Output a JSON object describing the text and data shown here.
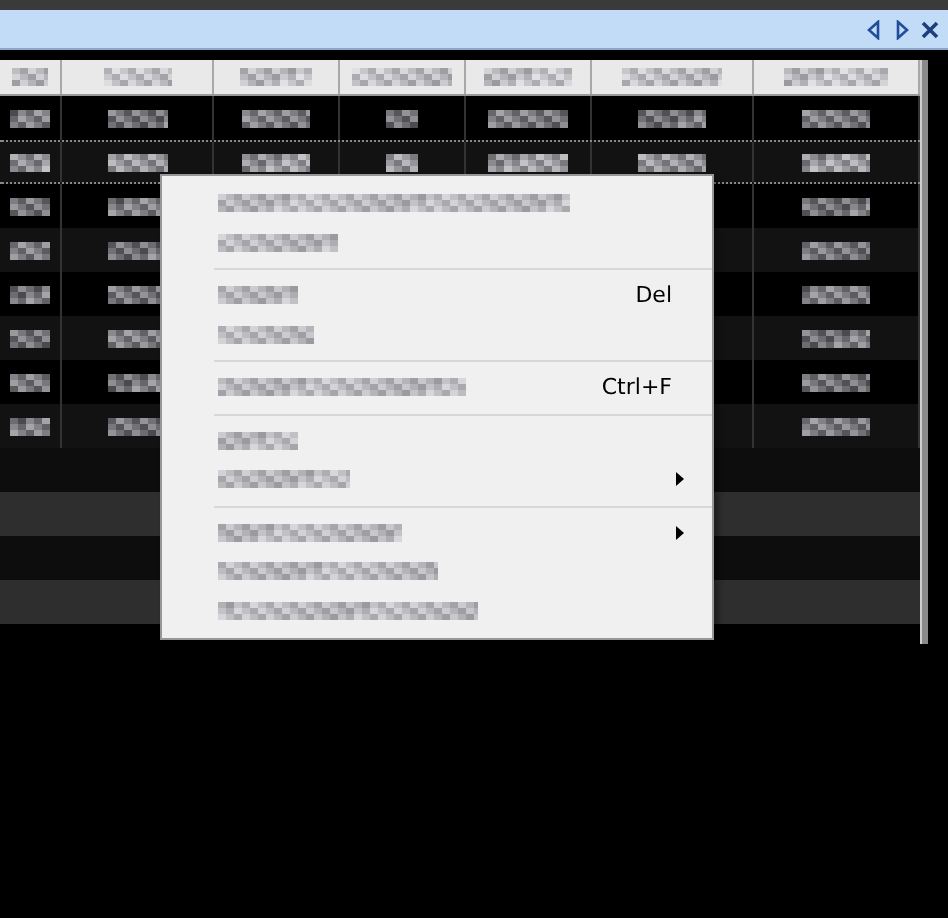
{
  "panel": {
    "buttons": [
      {
        "kind": "prev"
      },
      {
        "kind": "next"
      },
      {
        "kind": "close"
      }
    ]
  },
  "table": {
    "columns": [
      {
        "kind": "pixelated"
      },
      {
        "kind": "pixelated"
      },
      {
        "kind": "pixelated"
      },
      {
        "kind": "pixelated"
      },
      {
        "kind": "pixelated"
      },
      {
        "kind": "pixelated"
      },
      {
        "kind": "pixelated"
      }
    ],
    "rows": [
      {
        "kind": "data",
        "selected": false
      },
      {
        "kind": "data",
        "selected": true
      },
      {
        "kind": "data",
        "selected": false
      },
      {
        "kind": "data",
        "selected": false
      },
      {
        "kind": "data",
        "selected": false
      },
      {
        "kind": "data",
        "selected": false
      },
      {
        "kind": "data",
        "selected": false
      },
      {
        "kind": "data",
        "selected": false
      },
      {
        "kind": "empty",
        "selected": false
      },
      {
        "kind": "empty",
        "selected": false
      },
      {
        "kind": "empty",
        "selected": false
      },
      {
        "kind": "empty",
        "selected": false
      }
    ]
  },
  "context_menu": {
    "items": [
      {
        "kind": "item",
        "submenu": false
      },
      {
        "kind": "item",
        "submenu": false
      },
      {
        "kind": "separator"
      },
      {
        "kind": "item",
        "shortcut": "Del",
        "submenu": false
      },
      {
        "kind": "item",
        "submenu": false
      },
      {
        "kind": "separator"
      },
      {
        "kind": "item",
        "shortcut": "Ctrl+F",
        "submenu": false
      },
      {
        "kind": "separator"
      },
      {
        "kind": "item",
        "submenu": false
      },
      {
        "kind": "item",
        "submenu": true
      },
      {
        "kind": "separator"
      },
      {
        "kind": "item",
        "submenu": true
      },
      {
        "kind": "item",
        "submenu": false
      },
      {
        "kind": "item",
        "submenu": false
      }
    ]
  }
}
